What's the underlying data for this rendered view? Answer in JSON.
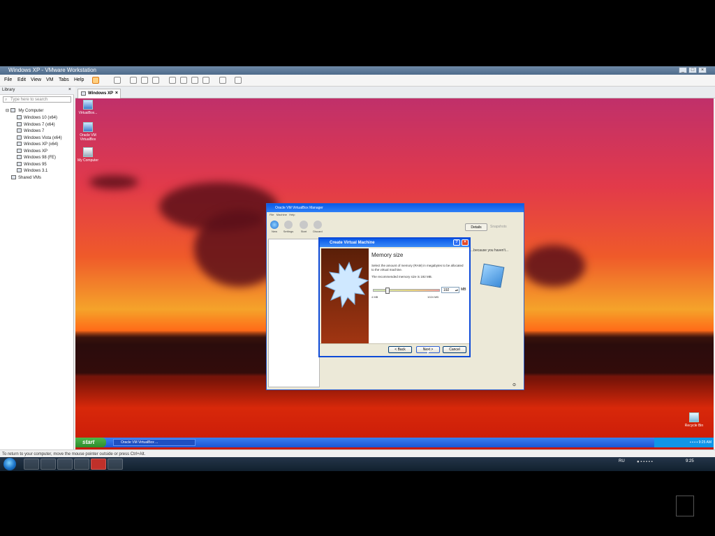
{
  "vmware": {
    "title": "Windows XP - VMware Workstation",
    "menu": [
      "File",
      "Edit",
      "View",
      "VM",
      "Tabs",
      "Help"
    ],
    "library": {
      "header": "Library",
      "search_placeholder": "Type here to search",
      "tree": {
        "root": "My Computer",
        "items": [
          "Windows 10 (x64)",
          "Windows 7 (x64)",
          "Windows 7",
          "Windows Vista (x64)",
          "Windows XP (x64)",
          "Windows XP",
          "Windows 98 (FE)",
          "Windows 95",
          "Windows 3.1"
        ],
        "shared": "Shared VMs"
      }
    },
    "tab": "Windows XP",
    "status": "To return to your computer, move the mouse pointer outside or press Ctrl+Alt."
  },
  "desktop_icons": [
    {
      "label": "VirtualBox..."
    },
    {
      "label": "Oracle VM VirtualBox"
    },
    {
      "label": "My Computer"
    },
    {
      "label": "Recycle Bin"
    }
  ],
  "xp_taskbar": {
    "start": "start",
    "task": "Oracle VM VirtualBox ...",
    "clock": "9:25 AM"
  },
  "virtualbox": {
    "title": "Oracle VM VirtualBox Manager",
    "menu": [
      "File",
      "Machine",
      "Help"
    ],
    "tools": [
      "New",
      "Settings",
      "Start",
      "Discard"
    ],
    "details": "Details",
    "snapshots": "Snapshots",
    "welcome": "...because you haven't..."
  },
  "wizard": {
    "title": "Create Virtual Machine",
    "heading": "Memory size",
    "description": "Select the amount of memory (RAM) in megabytes to be allocated to the virtual machine.",
    "recommended": "The recommended memory size is 192 MB.",
    "memory_value": "192",
    "unit": "MB",
    "min_label": "4 MB",
    "max_label": "1024 MB",
    "memory_fraction": 0.19,
    "buttons": {
      "back": "< Back",
      "next": "Next >",
      "cancel": "Cancel"
    }
  },
  "win7": {
    "lang": "RU",
    "clock": "9:25"
  }
}
